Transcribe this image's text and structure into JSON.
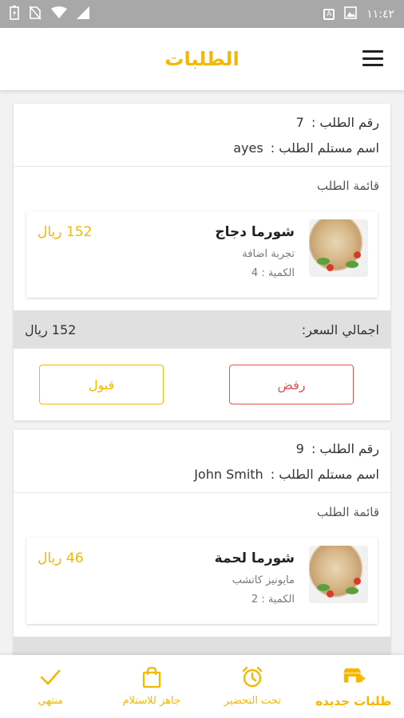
{
  "status_bar": {
    "time": "١١:٤٢",
    "a_badge": "A"
  },
  "app_bar": {
    "title": "الطلبات"
  },
  "orders": [
    {
      "number_label": "رقم الطلب :",
      "number": "7",
      "recipient_label": "اسم مستلم الطلب :",
      "recipient": "ayes",
      "list_title": "قائمة الطلب",
      "item": {
        "name": "شورما دجاج",
        "addon": "تجربة اضافة",
        "qty_label": "الكمية : 4",
        "price": "152 ريال"
      },
      "total_label": "اجمالي السعر:",
      "total": "152 ريال",
      "reject_label": "رفض",
      "accept_label": "قبول"
    },
    {
      "number_label": "رقم الطلب :",
      "number": "9",
      "recipient_label": "اسم مستلم الطلب :",
      "recipient": "John Smith",
      "list_title": "قائمة الطلب",
      "item": {
        "name": "شورما لحمة",
        "addon": "مايونيز  كاتشب",
        "qty_label": "الكمية : 2",
        "price": "46 ريال"
      }
    }
  ],
  "bottom_nav": [
    {
      "label": "طلبات جديده",
      "icon": "new-orders-icon",
      "active": true
    },
    {
      "label": "تحت التحضير",
      "icon": "alarm-clock-icon",
      "active": false
    },
    {
      "label": "جاهز للاستلام",
      "icon": "shopping-bag-icon",
      "active": false
    },
    {
      "label": "منتهي",
      "icon": "checkmark-icon",
      "active": false
    }
  ],
  "colors": {
    "accent": "#f5b700",
    "reject": "#e05454",
    "total_bg": "#e0e0e0"
  }
}
